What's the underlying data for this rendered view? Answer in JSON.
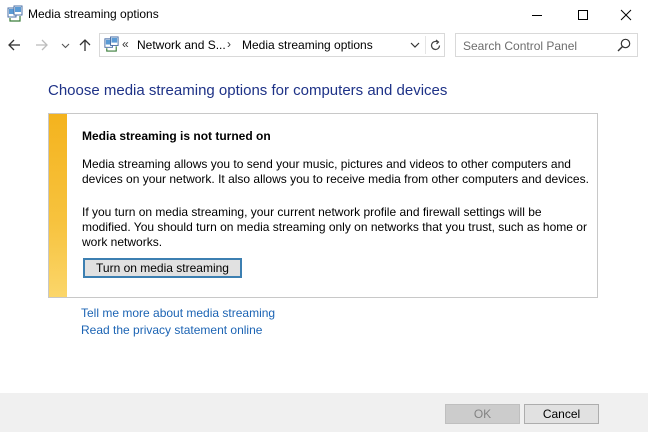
{
  "window": {
    "title": "Media streaming options",
    "icon": "control-panel-network-icon",
    "controls": [
      "minimize-icon",
      "maximize-icon",
      "close-icon"
    ]
  },
  "navigation": {
    "breadcrumb": [
      "Network and S...",
      "Media streaming options"
    ],
    "overflow_chevron": "«",
    "separator": "›",
    "search_placeholder": "Search Control Panel"
  },
  "main": {
    "heading": "Choose media streaming options for computers and devices",
    "notice": {
      "title": "Media streaming is not turned on",
      "paragraph1": "Media streaming allows you to send your music, pictures and videos to other computers and devices on your network.  It also allows you to receive media from other computers and devices.",
      "paragraph2": "If you turn on media streaming, your current network profile and firewall settings will be modified. You should turn on media streaming only on networks that you trust, such as home or work networks.",
      "button_label": "Turn on media streaming",
      "accent_color": "#f4b31e"
    },
    "links": [
      "Tell me more about media streaming",
      "Read the privacy statement online"
    ]
  },
  "footer": {
    "ok_label": "OK",
    "ok_enabled": false,
    "cancel_label": "Cancel"
  }
}
